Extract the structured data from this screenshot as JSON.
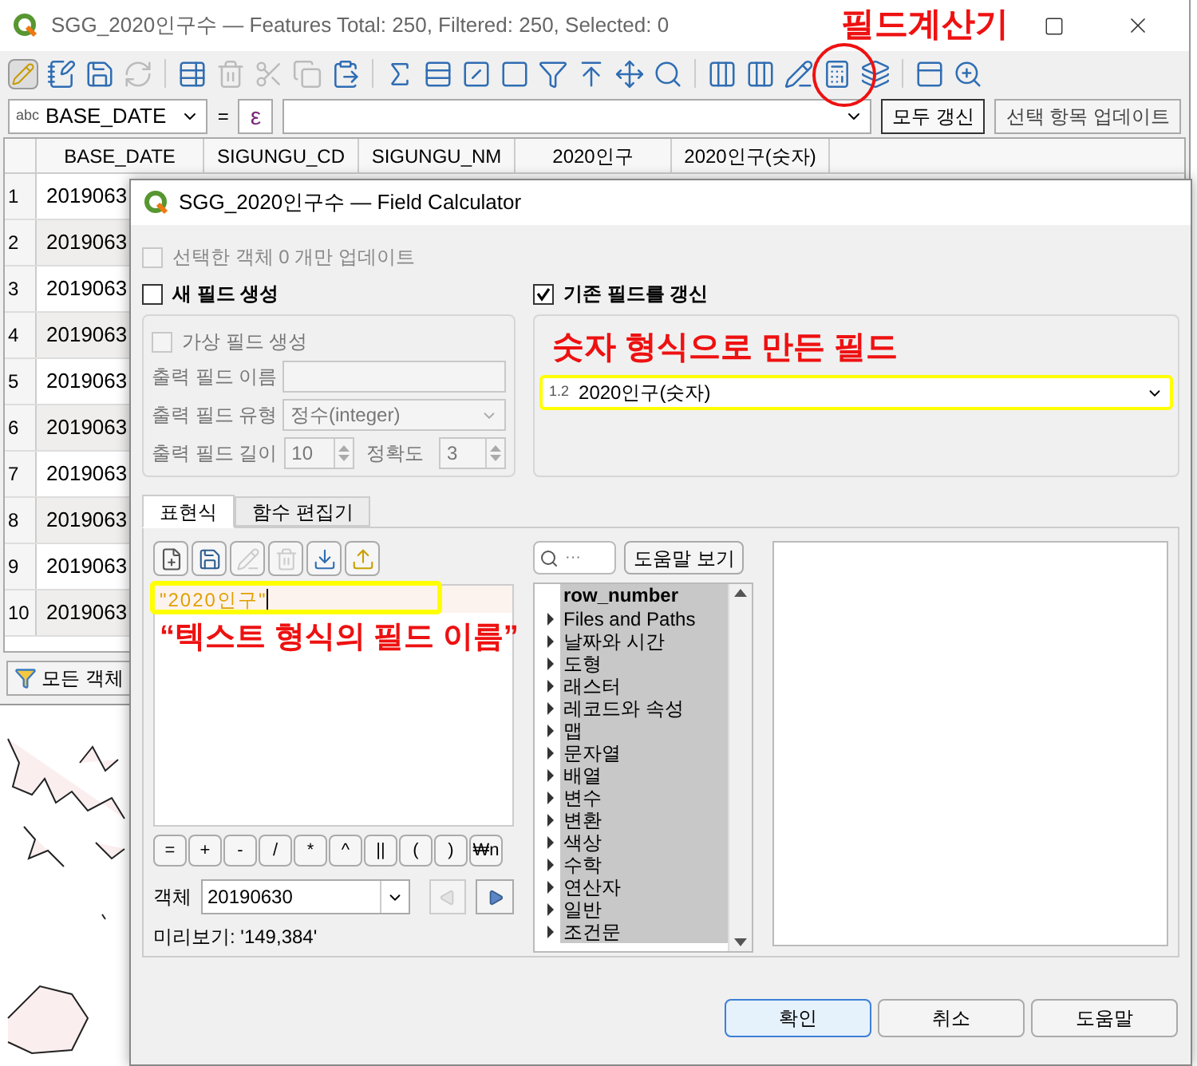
{
  "table_window": {
    "title": "SGG_2020인구수 — Features Total: 250, Filtered: 250, Selected: 0",
    "toolbar_annotation": "필드계산기",
    "filter": {
      "field_type": "abc",
      "field": "BASE_DATE",
      "operator": "=",
      "expression_button": "ε",
      "buttons": [
        "모두 갱신",
        "선택 항목 업데이트"
      ]
    },
    "columns": [
      "BASE_DATE",
      "SIGUNGU_CD",
      "SIGUNGU_NM",
      "2020인구",
      "2020인구(숫자)"
    ],
    "rows": [
      {
        "number": "1",
        "base_date": "2019063"
      },
      {
        "number": "2",
        "base_date": "2019063"
      },
      {
        "number": "3",
        "base_date": "2019063"
      },
      {
        "number": "4",
        "base_date": "2019063"
      },
      {
        "number": "5",
        "base_date": "2019063"
      },
      {
        "number": "6",
        "base_date": "2019063"
      },
      {
        "number": "7",
        "base_date": "2019063"
      },
      {
        "number": "8",
        "base_date": "2019063"
      },
      {
        "number": "9",
        "base_date": "2019063"
      },
      {
        "number": "10",
        "base_date": "2019063"
      }
    ],
    "filter_button": "모든 객체"
  },
  "dialog": {
    "title": "SGG_2020인구수 — Field Calculator",
    "update_selected_only": {
      "label": "선택한 객체 0 개만 업데이트",
      "checked": false,
      "disabled": true
    },
    "create_new_field": {
      "label": "새 필드 생성",
      "checked": false
    },
    "virtual_field": {
      "label": "가상 필드 생성",
      "checked": false
    },
    "output_name": {
      "label": "출력 필드 이름"
    },
    "output_type": {
      "label": "출력 필드 유형",
      "value": "정수(integer)"
    },
    "output_length": {
      "label": "출력 필드 길이",
      "value": "10"
    },
    "precision": {
      "label": "정확도",
      "value": "3"
    },
    "update_existing": {
      "label": "기존 필드를 갱신",
      "checked": true
    },
    "field_annotation": "숫자 형식으로 만든 필드",
    "existing_field": {
      "type": "1.2",
      "value": "2020인구(숫자)"
    },
    "tabs": [
      {
        "label": "표현식",
        "selected": true
      },
      {
        "label": "함수 편집기",
        "selected": false
      }
    ],
    "expression": "\"2020인구\"",
    "expression_annotation": "“텍스트 형식의 필드 이름”",
    "operators": [
      "=",
      "+",
      "-",
      "/",
      "*",
      "^",
      "||",
      "(",
      ")",
      "₩n"
    ],
    "feature": {
      "label": "객체",
      "value": "20190630"
    },
    "preview": "미리보기: '149,384'",
    "search": {
      "placeholder": "···"
    },
    "help_button": "도움말 보기",
    "functions": [
      {
        "label": "row_number",
        "kind": "item"
      },
      {
        "label": "Files and Paths",
        "kind": "group"
      },
      {
        "label": "날짜와 시간",
        "kind": "group"
      },
      {
        "label": "도형",
        "kind": "group"
      },
      {
        "label": "래스터",
        "kind": "group"
      },
      {
        "label": "레코드와 속성",
        "kind": "group"
      },
      {
        "label": "맵",
        "kind": "group"
      },
      {
        "label": "문자열",
        "kind": "group"
      },
      {
        "label": "배열",
        "kind": "group"
      },
      {
        "label": "변수",
        "kind": "group"
      },
      {
        "label": "변환",
        "kind": "group"
      },
      {
        "label": "색상",
        "kind": "group"
      },
      {
        "label": "수학",
        "kind": "group"
      },
      {
        "label": "연산자",
        "kind": "group"
      },
      {
        "label": "일반",
        "kind": "group"
      },
      {
        "label": "조건문",
        "kind": "group"
      }
    ],
    "buttons": [
      "확인",
      "취소",
      "도움말"
    ]
  }
}
